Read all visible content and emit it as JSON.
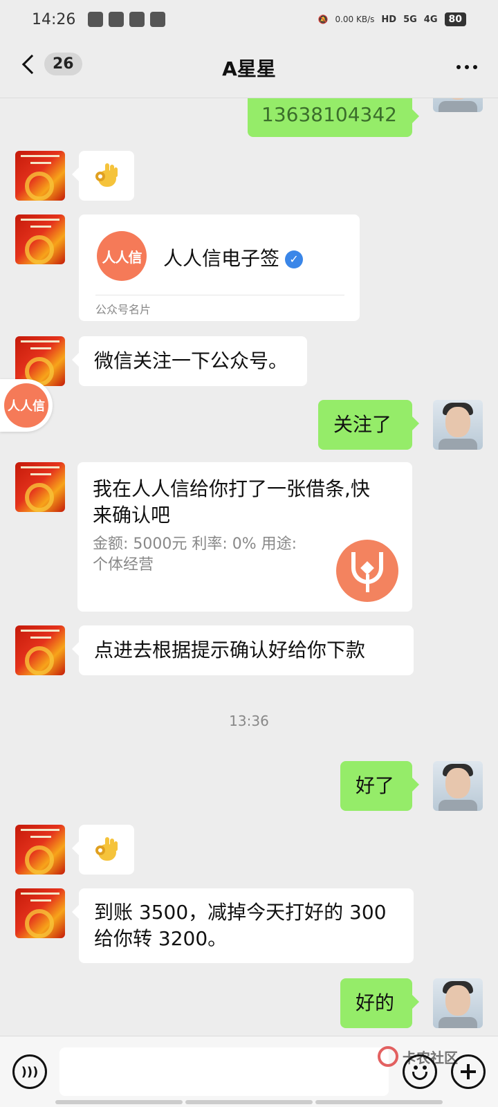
{
  "status_bar": {
    "time": "14:26",
    "net_speed": "0.00 KB/s",
    "hd": "HD",
    "signal1": "5G",
    "signal2": "4G",
    "battery": "80"
  },
  "header": {
    "unread_count": "26",
    "title": "A星星"
  },
  "messages": [
    {
      "from": "me",
      "type": "text",
      "text": "13638104342"
    },
    {
      "from": "peer",
      "type": "emoji",
      "emoji": "ok-hand"
    },
    {
      "from": "peer",
      "type": "card",
      "name": "人人信电子签",
      "logo_text": "人人信",
      "footer": "公众号名片"
    },
    {
      "from": "peer",
      "type": "text",
      "text": "微信关注一下公众号。"
    },
    {
      "from": "me",
      "type": "text",
      "text": "关注了"
    },
    {
      "from": "peer",
      "type": "loan_card",
      "line1": "我在人人信给你打了一张借条,快",
      "line2": "来确认吧",
      "detail1": "金额: 5000元 利率: 0% 用途:",
      "detail2": "个体经营"
    },
    {
      "from": "peer",
      "type": "text",
      "text": "点进去根据提示确认好给你下款"
    },
    {
      "type": "time",
      "text": "13:36"
    },
    {
      "from": "me",
      "type": "text",
      "text": "好了"
    },
    {
      "from": "peer",
      "type": "emoji",
      "emoji": "ok-hand"
    },
    {
      "from": "peer",
      "type": "text",
      "line1": "到账 3500，减掉今天打好的 300",
      "line2": "给你转 3200。"
    },
    {
      "from": "me",
      "type": "text",
      "text": "好的"
    }
  ],
  "floating_logo": "人人信",
  "input_bar": {
    "placeholder": "",
    "watermark": "卡农社区"
  }
}
